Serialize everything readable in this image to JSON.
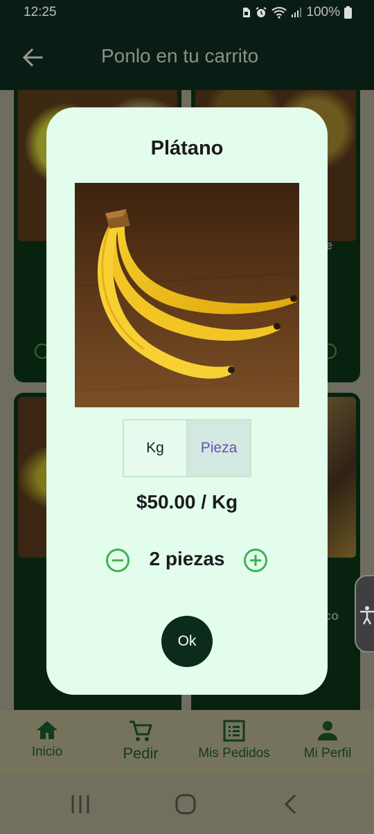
{
  "status_bar": {
    "time": "12:25",
    "battery": "100%",
    "icons": [
      "sim-icon",
      "alarm-icon",
      "wifi-icon",
      "signal-icon",
      "battery-icon"
    ]
  },
  "header": {
    "title": "Ponlo en tu carrito",
    "back_icon": "back-arrow-icon"
  },
  "background_cards": {
    "partial_text_right_1": "e",
    "partial_text_right_2": "co"
  },
  "dialog": {
    "title": "Plátano",
    "image_icon": "banana-image",
    "units": [
      {
        "label": "Kg",
        "selected": false
      },
      {
        "label": "Pieza",
        "selected": true
      }
    ],
    "price": "$50.00 / Kg",
    "quantity": "2 piezas",
    "ok_label": "Ok"
  },
  "bottom_nav": {
    "items": [
      {
        "label": "Inicio",
        "icon": "home-icon"
      },
      {
        "label": "Pedir",
        "icon": "cart-icon"
      },
      {
        "label": "Mis Pedidos",
        "icon": "list-icon"
      },
      {
        "label": "Mi Perfil",
        "icon": "person-icon"
      }
    ]
  },
  "colors": {
    "header_bg": "#0a1d14",
    "dialog_bg": "#e2fdec",
    "accent_green": "#3fb14f",
    "ok_button": "#0b2c1a",
    "selected_unit_text": "#6b4fa6"
  }
}
